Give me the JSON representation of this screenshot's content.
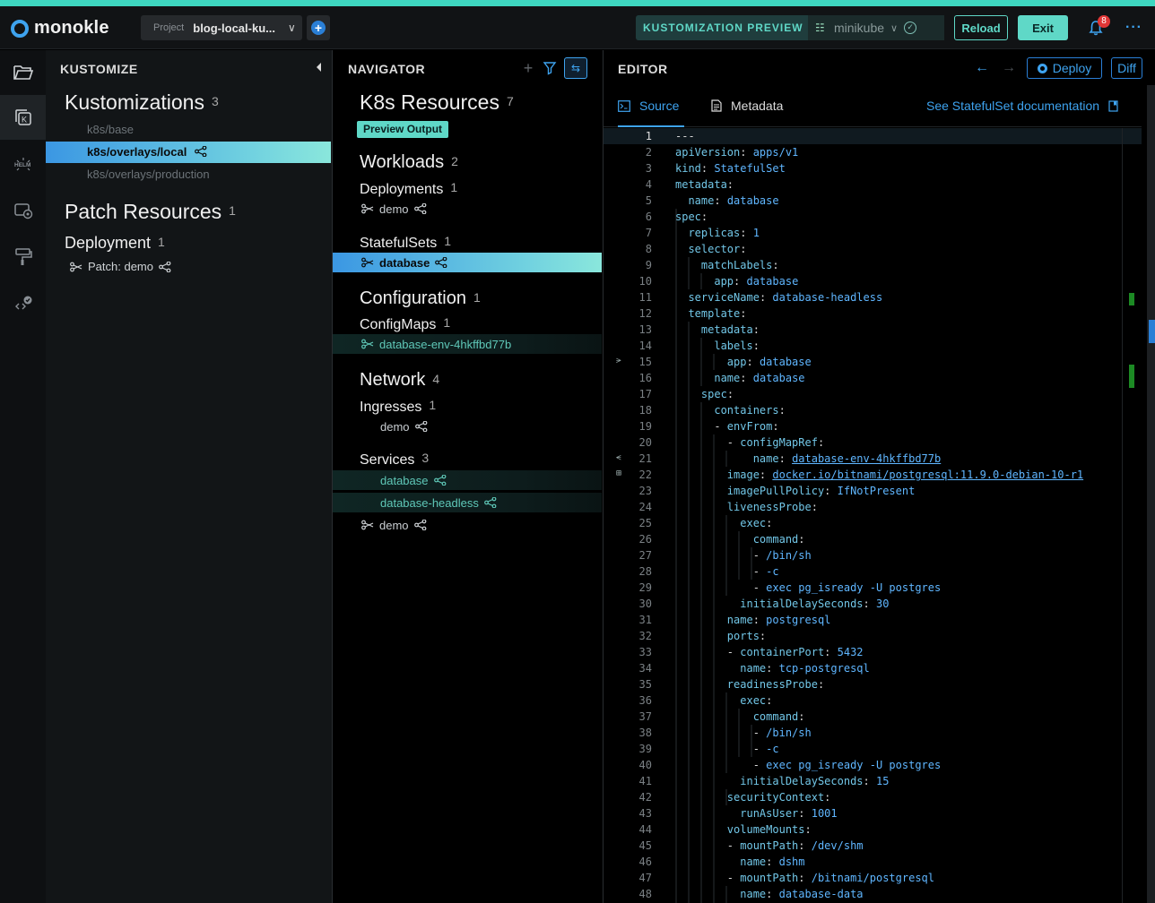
{
  "header": {
    "logo_text": "monokle",
    "project_label": "Project",
    "project_value": "blog-local-ku...",
    "mode_label": "KUSTOMIZATION PREVIEW",
    "cluster_name": "minikube",
    "reload_label": "Reload",
    "exit_label": "Exit",
    "notification_count": "8",
    "more_label": "···"
  },
  "kustomize_panel": {
    "title": "KUSTOMIZE",
    "kustomizations_heading": "Kustomizations",
    "kustomizations_count": "3",
    "kustomizations": [
      "k8s/base",
      "k8s/overlays/local",
      "k8s/overlays/production"
    ],
    "patch_heading": "Patch Resources",
    "patch_count": "1",
    "deployment_heading": "Deployment",
    "deployment_count": "1",
    "patch_item": "Patch: demo"
  },
  "navigator": {
    "title": "NAVIGATOR",
    "k8s_heading": "K8s Resources",
    "k8s_count": "7",
    "preview_output_label": "Preview Output",
    "workloads_heading": "Workloads",
    "workloads_count": "2",
    "deployments_heading": "Deployments",
    "deployments_count": "1",
    "deployment_item": "demo",
    "statefulsets_heading": "StatefulSets",
    "statefulsets_count": "1",
    "statefulset_item": "database",
    "configuration_heading": "Configuration",
    "configuration_count": "1",
    "configmaps_heading": "ConfigMaps",
    "configmaps_count": "1",
    "configmap_item": "database-env-4hkffbd77b",
    "network_heading": "Network",
    "network_count": "4",
    "ingresses_heading": "Ingresses",
    "ingresses_count": "1",
    "ingress_item": "demo",
    "services_heading": "Services",
    "services_count": "3",
    "service_items": [
      "database",
      "database-headless",
      "demo"
    ]
  },
  "editor": {
    "title": "EDITOR",
    "deploy_label": "Deploy",
    "diff_label": "Diff",
    "tab_source": "Source",
    "tab_metadata": "Metadata",
    "doc_link": "See StatefulSet documentation",
    "lines": [
      "---",
      "apiVersion: apps/v1",
      "kind: StatefulSet",
      "metadata:",
      "  name: database",
      "spec:",
      "  replicas: 1",
      "  selector:",
      "    matchLabels:",
      "      app: database",
      "  serviceName: database-headless",
      "  template:",
      "    metadata:",
      "      labels:",
      "        app: database",
      "      name: database",
      "    spec:",
      "      containers:",
      "      - envFrom:",
      "        - configMapRef:",
      "            name: database-env-4hkffbd77b",
      "        image: docker.io/bitnami/postgresql:11.9.0-debian-10-r1",
      "        imagePullPolicy: IfNotPresent",
      "        livenessProbe:",
      "          exec:",
      "            command:",
      "            - /bin/sh",
      "            - -c",
      "            - exec pg_isready -U postgres",
      "          initialDelaySeconds: 30",
      "        name: postgresql",
      "        ports:",
      "        - containerPort: 5432",
      "          name: tcp-postgresql",
      "        readinessProbe:",
      "          exec:",
      "            command:",
      "            - /bin/sh",
      "            - -c",
      "            - exec pg_isready -U postgres",
      "          initialDelaySeconds: 15",
      "        securityContext:",
      "          runAsUser: 1001",
      "        volumeMounts:",
      "        - mountPath: /dev/shm",
      "          name: dshm",
      "        - mountPath: /bitnami/postgresql",
      "          name: database-data"
    ]
  }
}
